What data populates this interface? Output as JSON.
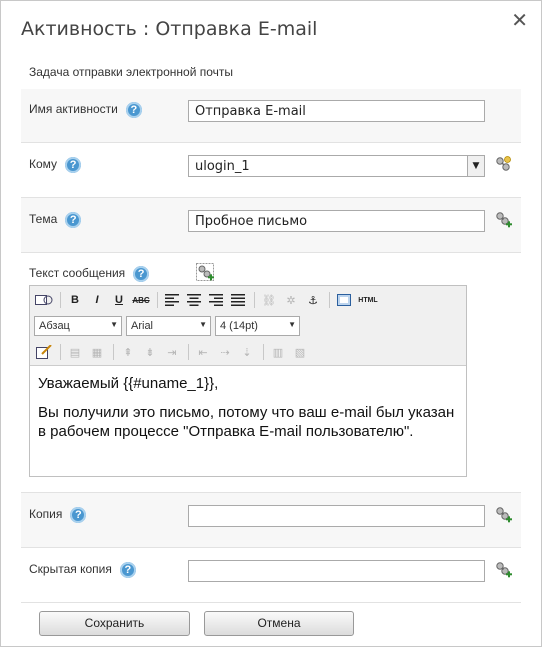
{
  "dialog": {
    "title": "Активность : Отправка E-mail",
    "section_title": "Задача отправки электронной почты"
  },
  "fields": {
    "name": {
      "label": "Имя активности",
      "value": "Отправка E-mail"
    },
    "to": {
      "label": "Кому",
      "value": "ulogin_1"
    },
    "subject": {
      "label": "Тема",
      "value": "Пробное письмо"
    },
    "message": {
      "label": "Текст сообщения"
    },
    "cc": {
      "label": "Копия",
      "value": ""
    },
    "bcc": {
      "label": "Скрытая копия",
      "value": ""
    }
  },
  "help_glyph": "?",
  "editor": {
    "format_select": "Абзац",
    "font_select": "Arial",
    "size_select": "4 (14pt)",
    "toolbar": {
      "bold": "B",
      "italic": "I",
      "underline": "U",
      "strike": "ABC",
      "html": "HTML"
    },
    "content": {
      "line1": "Уважаемый {{#uname_1}},",
      "line2": "Вы получили это письмо, потому что ваш e-mail был указан в рабочем процессе \"Отправка E-mail пользователю\"."
    }
  },
  "buttons": {
    "save": "Сохранить",
    "cancel": "Отмена"
  },
  "colors": {
    "help": "#4a97d0",
    "plug": "#2e8b2e"
  }
}
